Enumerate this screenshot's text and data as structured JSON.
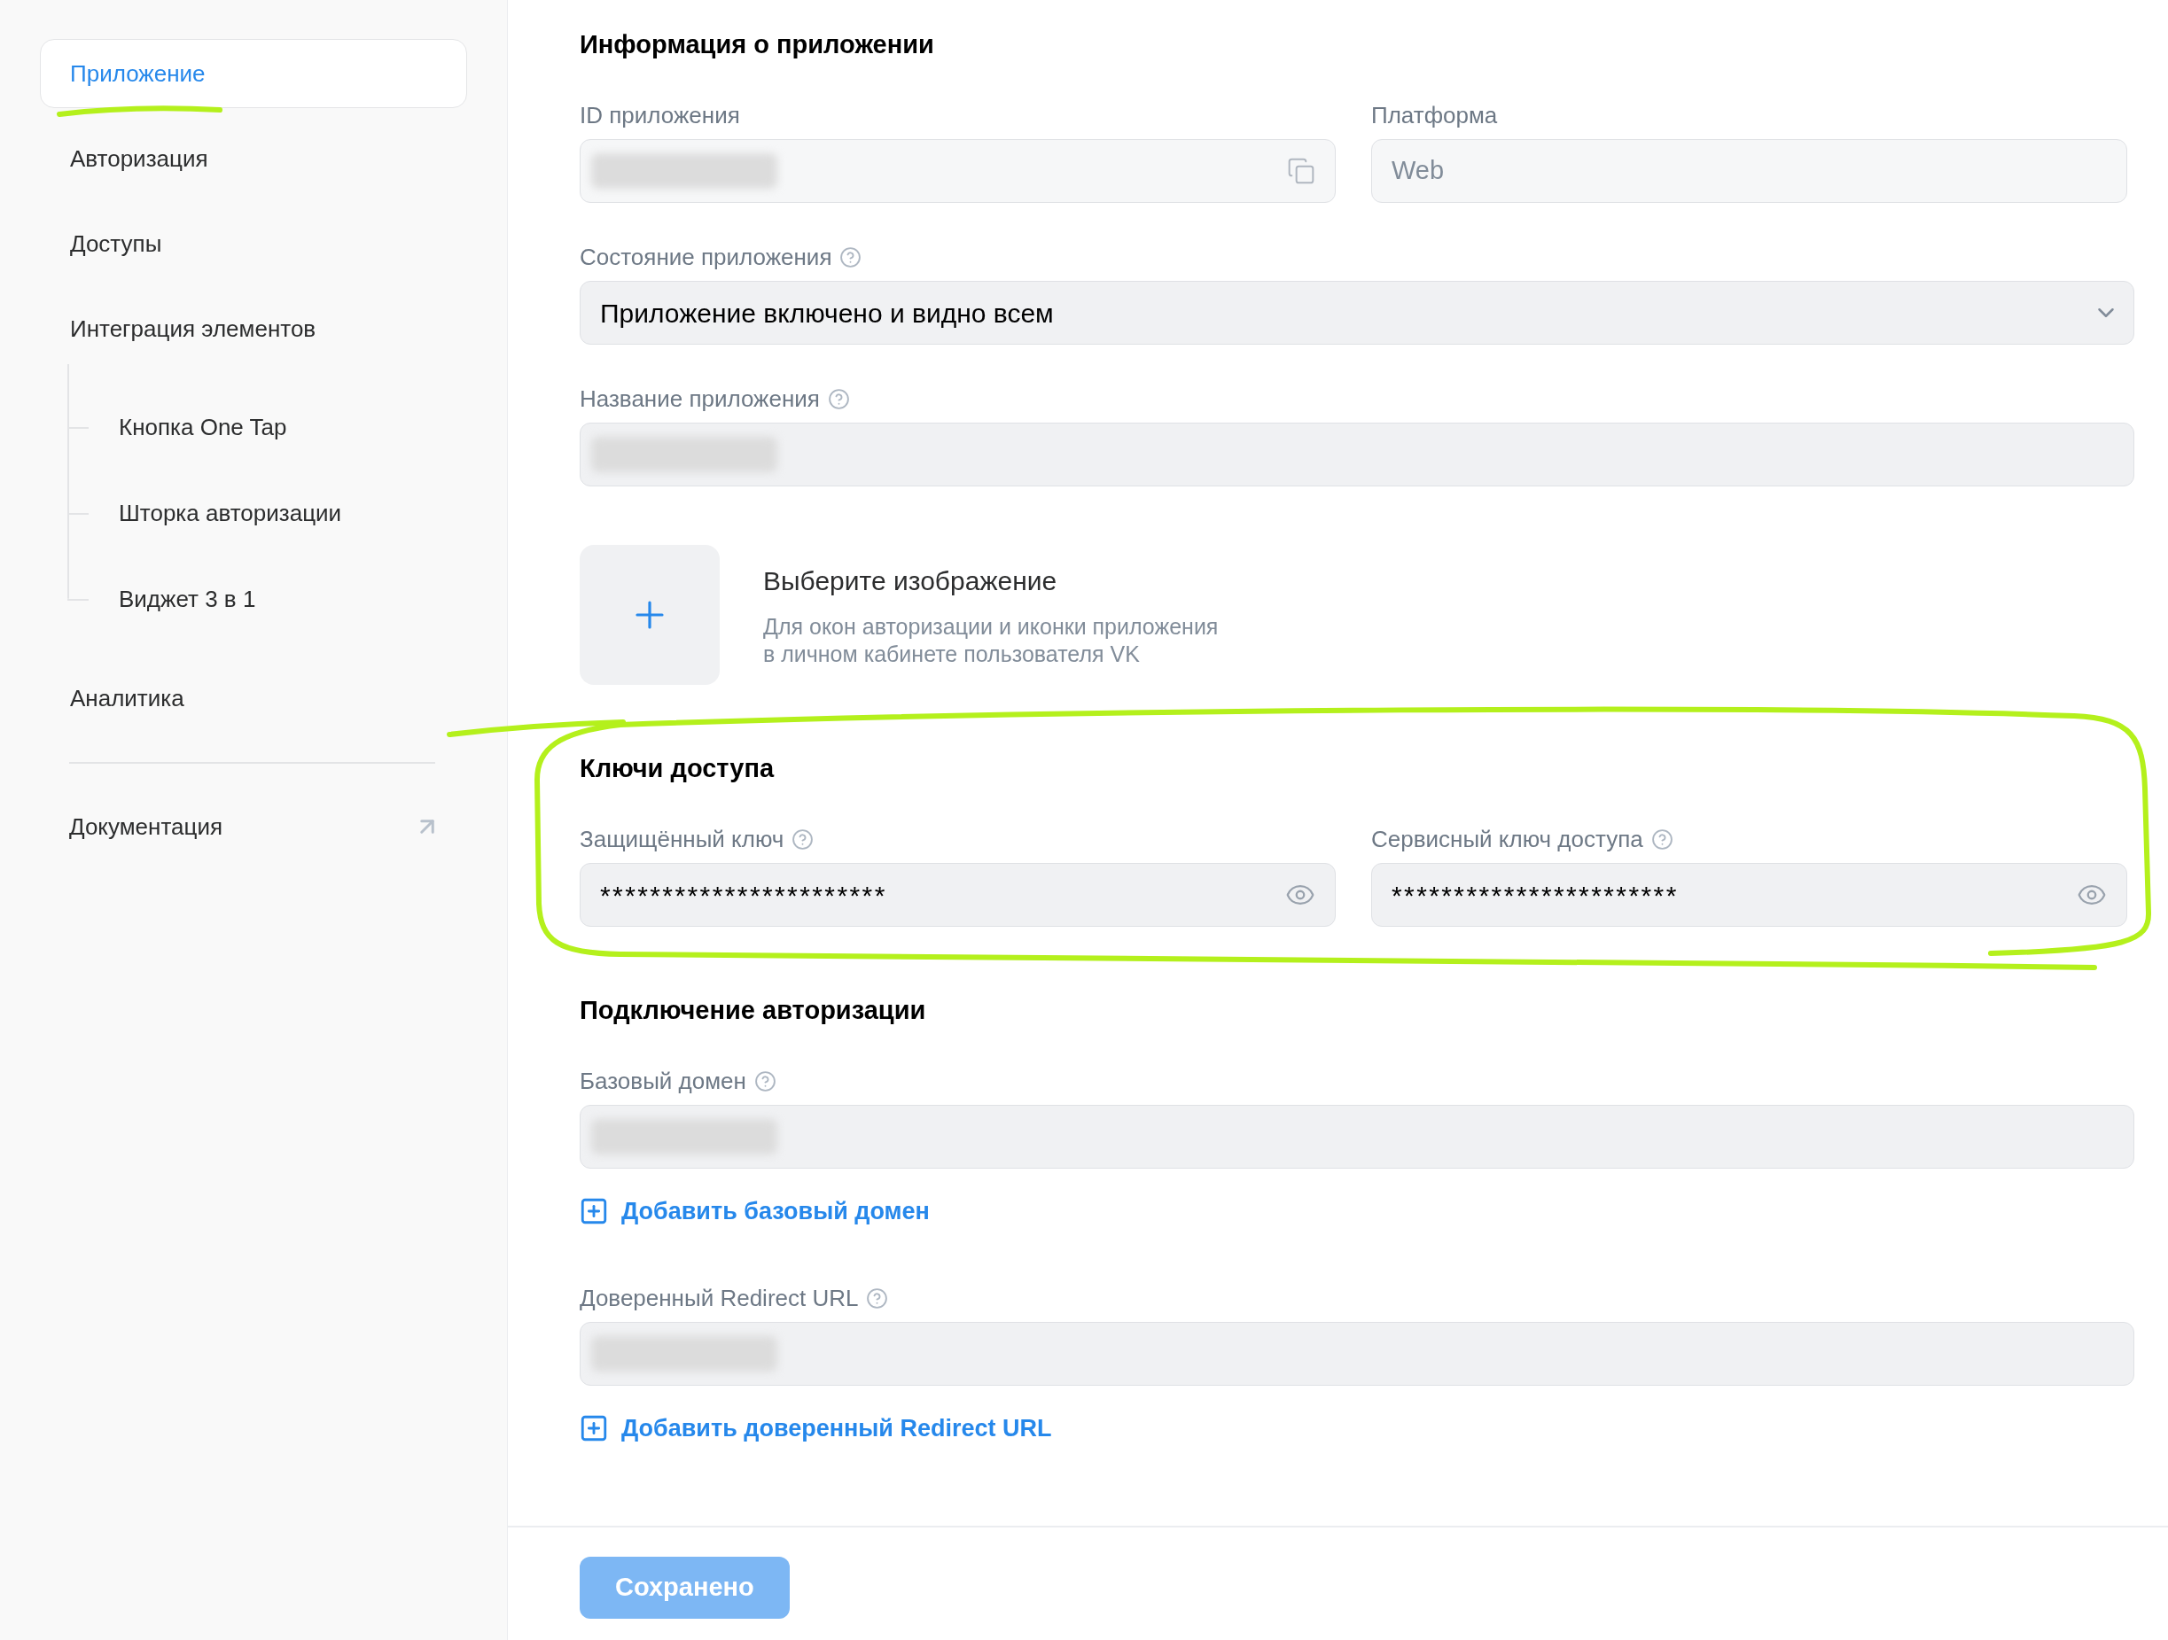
{
  "sidebar": {
    "items": [
      {
        "label": "Приложение",
        "selected": true
      },
      {
        "label": "Авторизация",
        "selected": false
      },
      {
        "label": "Доступы",
        "selected": false
      },
      {
        "label": "Интеграция элементов",
        "selected": false,
        "children": [
          {
            "label": "Кнопка One Tap",
            "selected": false
          },
          {
            "label": "Шторка авторизации",
            "selected": false
          },
          {
            "label": "Виджет 3 в 1",
            "selected": false
          }
        ]
      },
      {
        "label": "Аналитика",
        "selected": false
      }
    ],
    "footer_links": [
      {
        "label": "Документация",
        "external": true
      }
    ]
  },
  "sections": [
    {
      "title": "Информация о приложении",
      "rows": [
        [
          {
            "kind": "copyable",
            "label": "ID приложения",
            "readonly": true,
            "redacted": true
          },
          {
            "kind": "text",
            "label": "Платформа",
            "readonly": true,
            "value": "Web"
          }
        ],
        [
          {
            "kind": "select",
            "label": "Состояние приложения",
            "help": true,
            "value": "Приложение включено и видно всем"
          }
        ],
        [
          {
            "kind": "text",
            "label": "Название приложения",
            "help": true,
            "redacted": true
          }
        ],
        [
          {
            "kind": "image_picker",
            "title": "Выберите изображение",
            "description": "Для окон авторизации и иконки приложения\nв личном кабинете пользователя VK"
          }
        ]
      ]
    },
    {
      "title": "Ключи доступа",
      "rows": [
        [
          {
            "kind": "secret",
            "label": "Защищённый ключ",
            "help": true,
            "value": "***********************"
          },
          {
            "kind": "secret",
            "label": "Сервисный ключ доступа",
            "help": true,
            "value": "***********************"
          }
        ]
      ]
    },
    {
      "title": "Подключение авторизации",
      "rows": [
        [
          {
            "kind": "text",
            "label": "Базовый домен",
            "help": true,
            "redacted": true,
            "add_link": "Добавить базовый домен"
          }
        ],
        [
          {
            "kind": "text",
            "label": "Доверенный Redirect URL",
            "help": true,
            "redacted": true,
            "add_link": "Добавить доверенный Redirect URL"
          }
        ]
      ]
    }
  ],
  "save_button": {
    "label": "Сохранено",
    "disabled": true
  }
}
